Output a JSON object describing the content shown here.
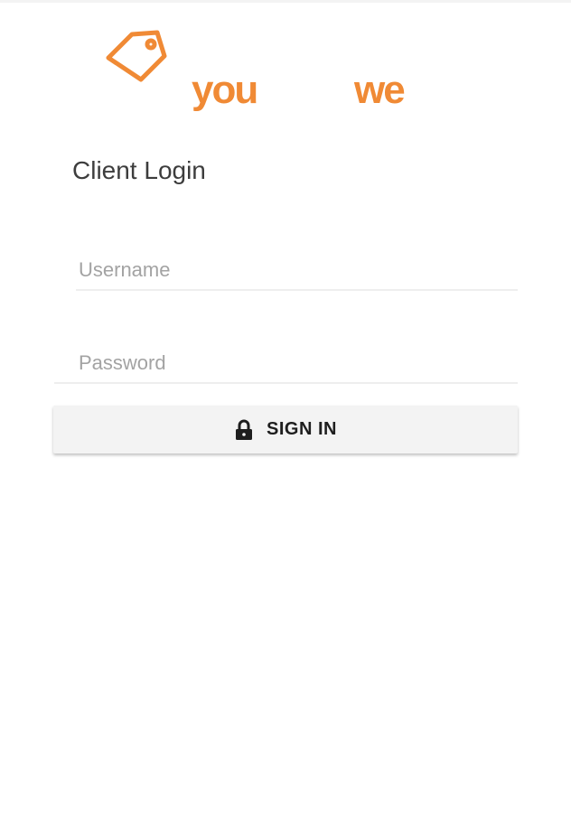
{
  "brand": {
    "icon": "price-tag-icon",
    "word_left": "you",
    "word_right": "we",
    "color": "#f08a35"
  },
  "login": {
    "title": "Client Login",
    "username_placeholder": "Username",
    "username_value": "",
    "password_placeholder": "Password",
    "password_value": "",
    "sign_in_label": "SIGN IN",
    "sign_in_icon": "lock-icon"
  }
}
